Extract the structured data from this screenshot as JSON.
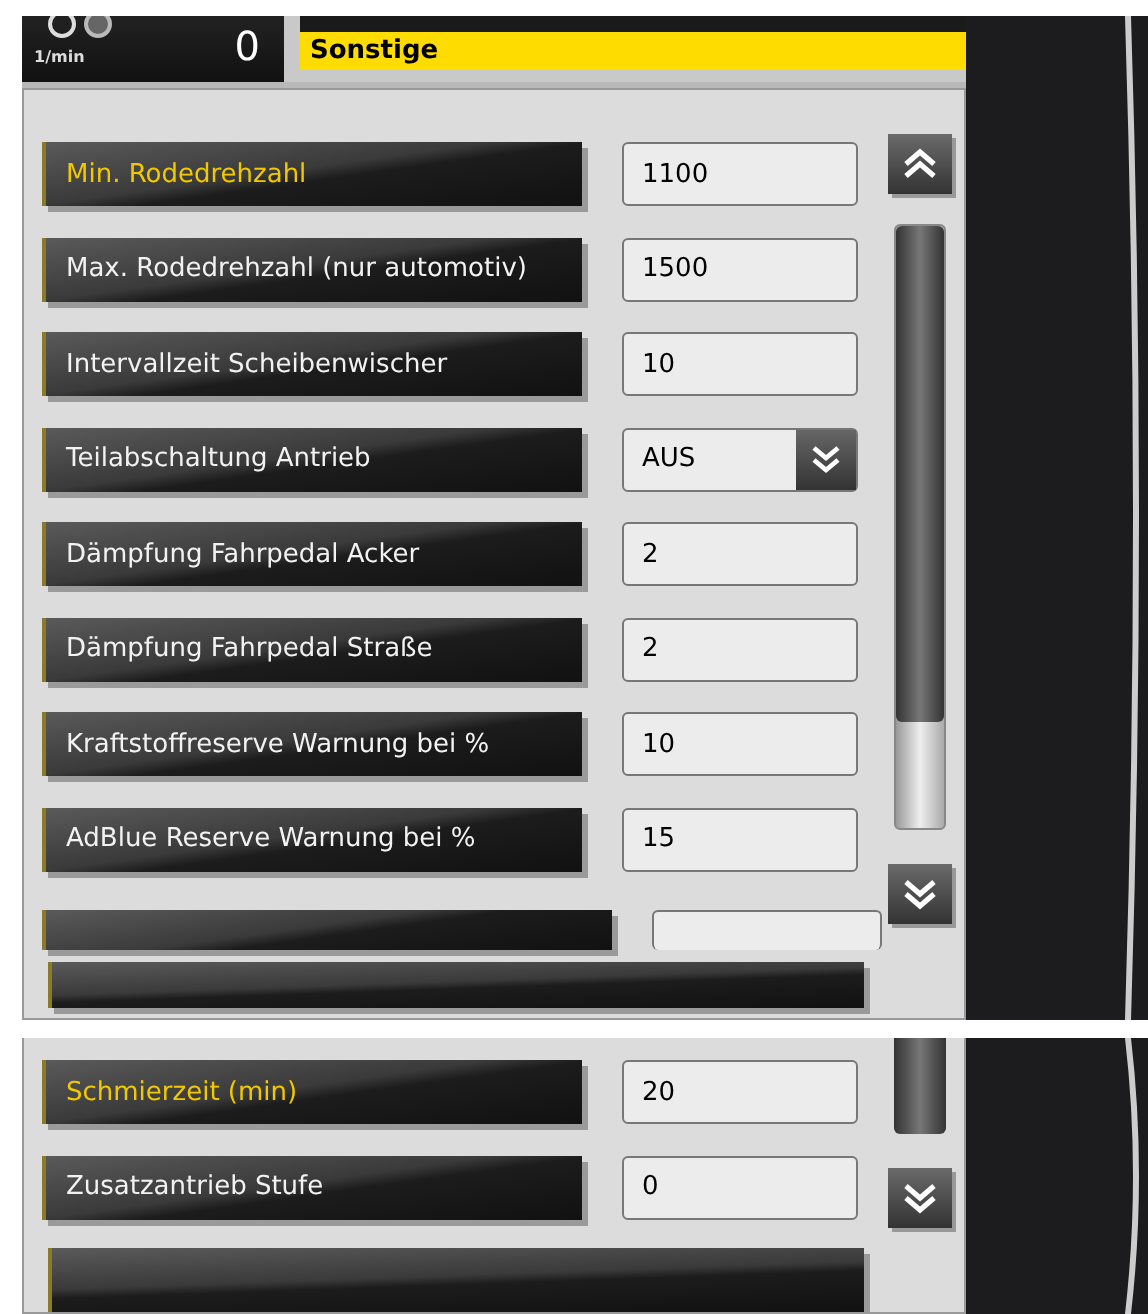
{
  "header": {
    "unit": "1/min",
    "value": "0",
    "section_title": "Sonstige"
  },
  "settings": [
    {
      "label": "Min. Rodedrehzahl",
      "value": "1100",
      "kind": "field",
      "selected": true
    },
    {
      "label": "Max. Rodedrehzahl (nur automotiv)",
      "value": "1500",
      "kind": "field",
      "selected": false
    },
    {
      "label": "Intervallzeit Scheibenwischer",
      "value": "10",
      "kind": "field",
      "selected": false
    },
    {
      "label": "Teilabschaltung Antrieb",
      "value": "AUS",
      "kind": "dropdown",
      "selected": false
    },
    {
      "label": "Dämpfung Fahrpedal Acker",
      "value": "2",
      "kind": "field",
      "selected": false
    },
    {
      "label": "Dämpfung Fahrpedal Straße",
      "value": "2",
      "kind": "field",
      "selected": false
    },
    {
      "label": "Kraftstoffreserve Warnung bei %",
      "value": "10",
      "kind": "field",
      "selected": false
    },
    {
      "label": "AdBlue Reserve Warnung bei %",
      "value": "15",
      "kind": "field",
      "selected": false
    }
  ],
  "second_view": {
    "settings": [
      {
        "label": "Schmierzeit (min)",
        "value": "20",
        "kind": "field",
        "selected": true
      },
      {
        "label": "Zusatzantrieb Stufe",
        "value": "0",
        "kind": "field",
        "selected": false
      }
    ]
  }
}
